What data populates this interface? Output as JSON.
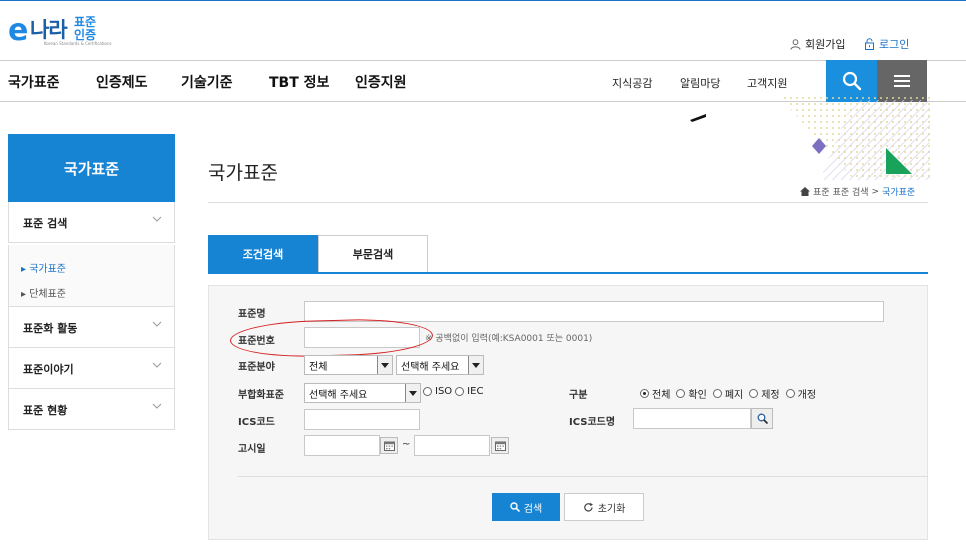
{
  "logo": {
    "e": "e",
    "nara": "나라",
    "pyojun": "표준",
    "injeung": "인증",
    "sub": "Korean Standards & Certifications"
  },
  "util": {
    "join": "회원가입",
    "login": "로그인"
  },
  "gnb": [
    "국가표준",
    "인증제도",
    "기술기준",
    "TBT 정보",
    "인증지원"
  ],
  "subnav": [
    "지식공감",
    "알림마당",
    "고객지원"
  ],
  "sidebar": {
    "title": "국가표준",
    "items": [
      {
        "label": "표준 검색"
      },
      {
        "label": "표준화 활동"
      },
      {
        "label": "표준이야기"
      },
      {
        "label": "표준 현황"
      }
    ],
    "sub": [
      {
        "label": "▸ 국가표준"
      },
      {
        "label": "▸ 단체표준"
      }
    ]
  },
  "page": {
    "title": "국가표준",
    "breadcrumb": [
      "표준",
      "표준 검색",
      "국가표준"
    ]
  },
  "tabs": [
    "조건검색",
    "부문검색"
  ],
  "form": {
    "name_label": "표준명",
    "number_label": "표준번호",
    "number_hint": "※ 공백없이 입력(예:KSA0001 또는 0001)",
    "field_label": "표준분야",
    "field_select1": "전체",
    "field_select2": "선택해 주세요",
    "conform_label": "부합화표준",
    "conform_select": "선택해 주세요",
    "conform_options": [
      "ISO",
      "IEC"
    ],
    "type_label": "구분",
    "type_options": [
      "전체",
      "확인",
      "폐지",
      "제정",
      "개정"
    ],
    "ics_label": "ICS코드",
    "ics_name_label": "ICS코드명",
    "date_label": "고시일",
    "tilde": "~"
  },
  "buttons": {
    "search": "검색",
    "reset": "초기화"
  },
  "colors": {
    "primary": "#1783d3",
    "annotation": "#d42020"
  }
}
